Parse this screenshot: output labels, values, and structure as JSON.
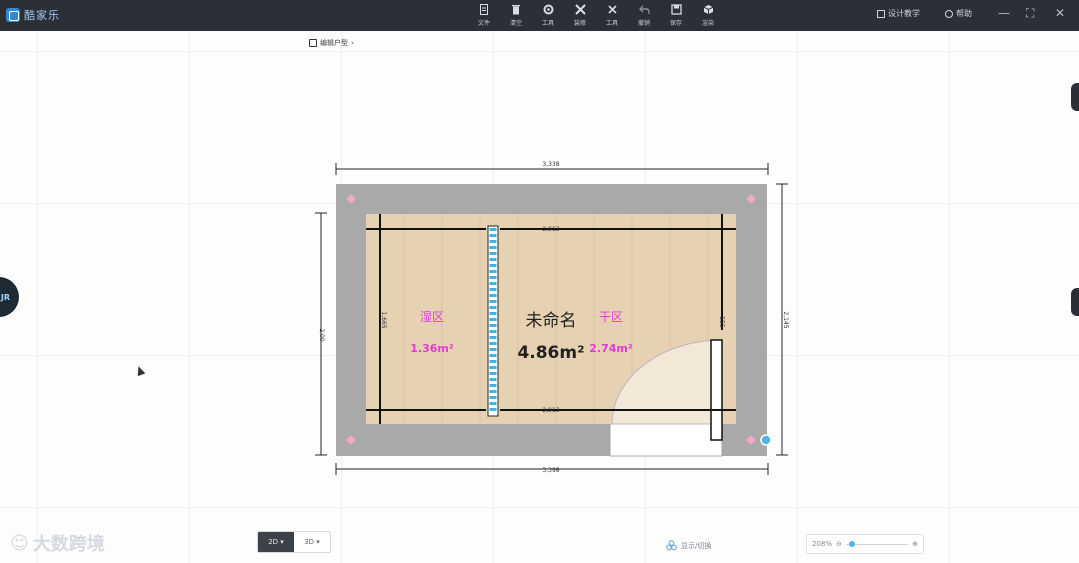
{
  "app": {
    "name": "酷家乐"
  },
  "toolbar": [
    {
      "label": "文件",
      "icon": "file-icon"
    },
    {
      "label": "清空",
      "icon": "trash-icon"
    },
    {
      "label": "工具",
      "icon": "gear-icon"
    },
    {
      "label": "装修",
      "icon": "tools-icon"
    },
    {
      "label": "工具",
      "icon": "wrench-icon"
    },
    {
      "label": "撤销",
      "icon": "undo-icon"
    },
    {
      "label": "保存",
      "icon": "save-icon"
    },
    {
      "label": "渲染",
      "icon": "cube-icon"
    }
  ],
  "topright": {
    "tutorial": "设计教学",
    "help": "帮助"
  },
  "breadcrumb": {
    "label": "编辑户型"
  },
  "plan": {
    "room_name": "未命名",
    "room_area": "4.86m²",
    "wet_zone": {
      "name": "湿区",
      "area": "1.36m²"
    },
    "dry_zone": {
      "name": "干区",
      "area": "2.74m²"
    },
    "dims": {
      "top": "3,338",
      "bottom": "3,398",
      "left": "2,00",
      "right": "2,145",
      "inner_top": "2,913",
      "inner_bottom": "2,913",
      "inner_left": "1,665",
      "inner_right": "555"
    }
  },
  "view_toggle": {
    "two_d": "2D",
    "three_d": "3D"
  },
  "hint": {
    "label": "显示/切换"
  },
  "zoom": {
    "level": "208%",
    "value": 0.05
  },
  "watermark": {
    "text": "大数跨境"
  },
  "colors": {
    "wall": "#a9a9a9",
    "floor": "#e6d2b3",
    "zone": "#e23ad6",
    "accent": "#4fb4e6",
    "topbar": "#2b3036"
  }
}
